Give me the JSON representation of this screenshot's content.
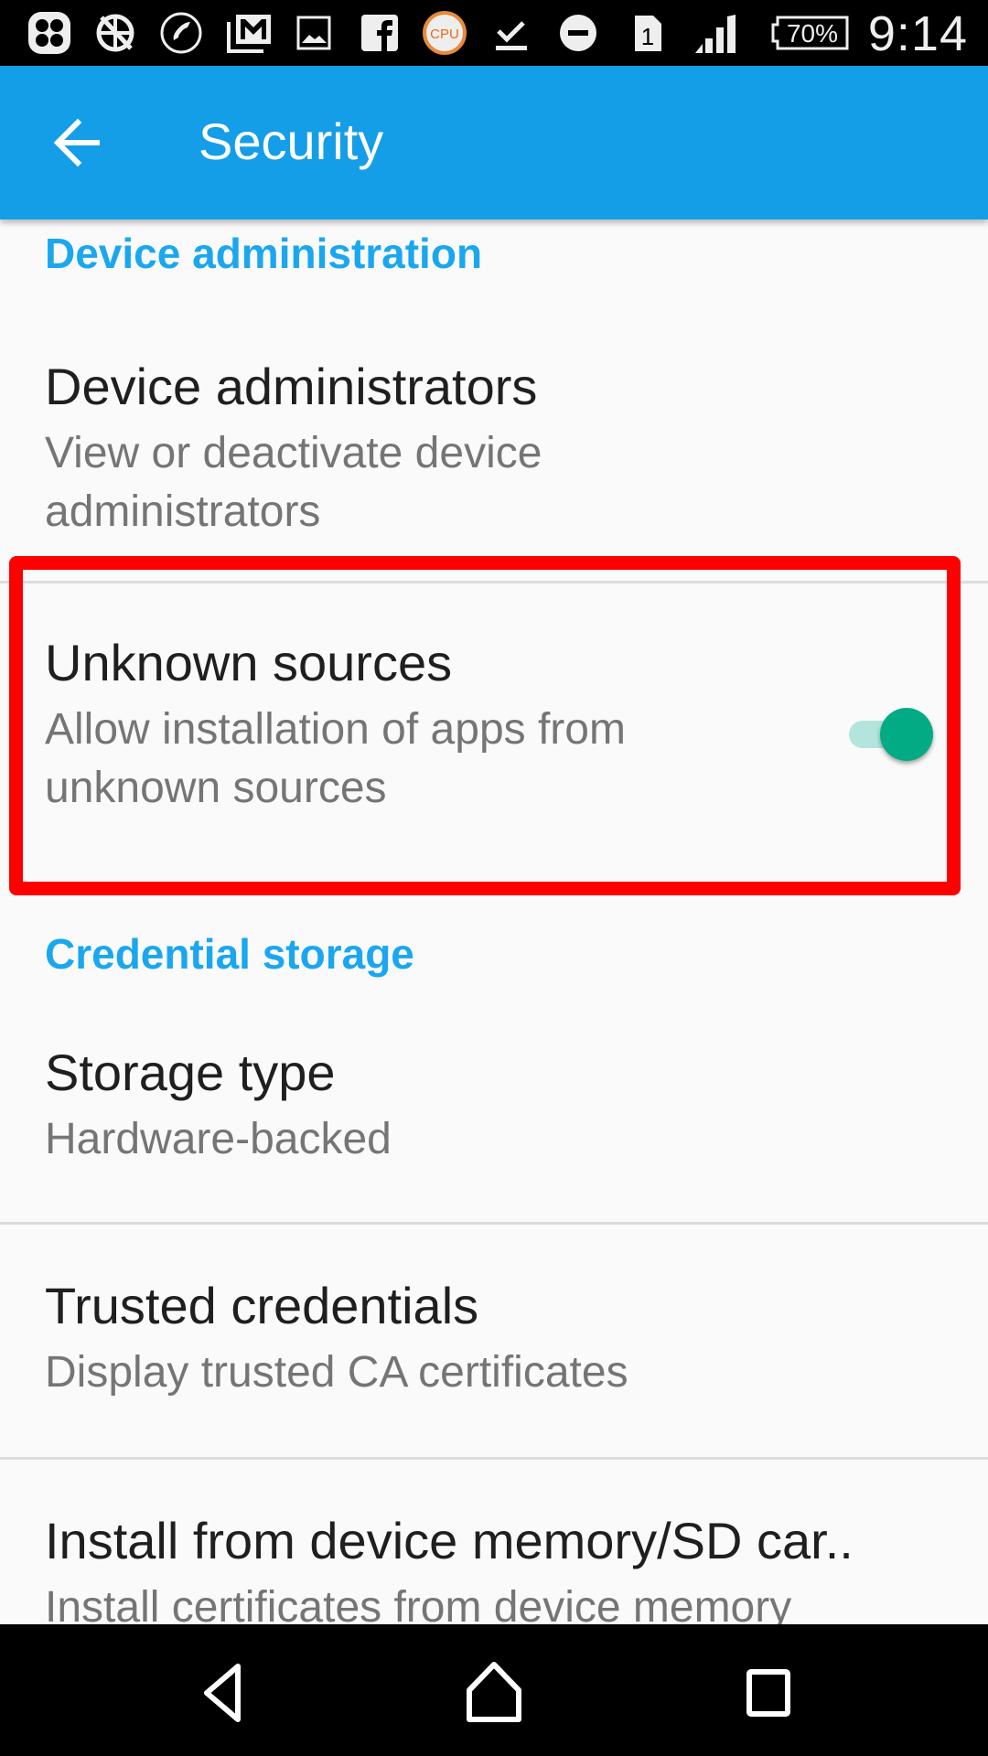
{
  "status_bar": {
    "icons": [
      "clover-app-icon",
      "no-network-globe-icon",
      "phone-call-icon",
      "gmail-icon",
      "image-icon",
      "facebook-icon",
      "cpu-monitor-icon",
      "download-done-icon",
      "do-not-disturb-icon",
      "sim-1-icon",
      "signal-icon",
      "battery-icon"
    ],
    "cpu_label": "CPU",
    "sim_label": "1",
    "battery": "70%",
    "time": "9:14"
  },
  "toolbar": {
    "title": "Security",
    "back_icon": "arrow-left-icon"
  },
  "sections": [
    {
      "header": "Device administration",
      "items": [
        {
          "title": "Device administrators",
          "summary_lines": [
            "View or deactivate device",
            "administrators"
          ]
        },
        {
          "title": "Unknown sources",
          "summary_lines": [
            "Allow installation of apps from",
            "unknown sources"
          ],
          "toggle": true
        }
      ]
    },
    {
      "header": "Credential storage",
      "items": [
        {
          "title": "Storage type",
          "summary_lines": [
            "Hardware-backed"
          ]
        },
        {
          "title": "Trusted credentials",
          "summary_lines": [
            "Display trusted CA certificates"
          ]
        },
        {
          "title": "Install from device memory/SD car..",
          "summary_lines": [
            "Install certificates from device memory"
          ]
        }
      ]
    }
  ],
  "colors": {
    "toolbar": "#149ee8",
    "category": "#1aa7ef",
    "toggle_on": "#03ab85",
    "highlight": "#ff0000"
  },
  "navbar": {
    "back": "nav-back-icon",
    "home": "nav-home-icon",
    "recents": "nav-recents-icon"
  }
}
